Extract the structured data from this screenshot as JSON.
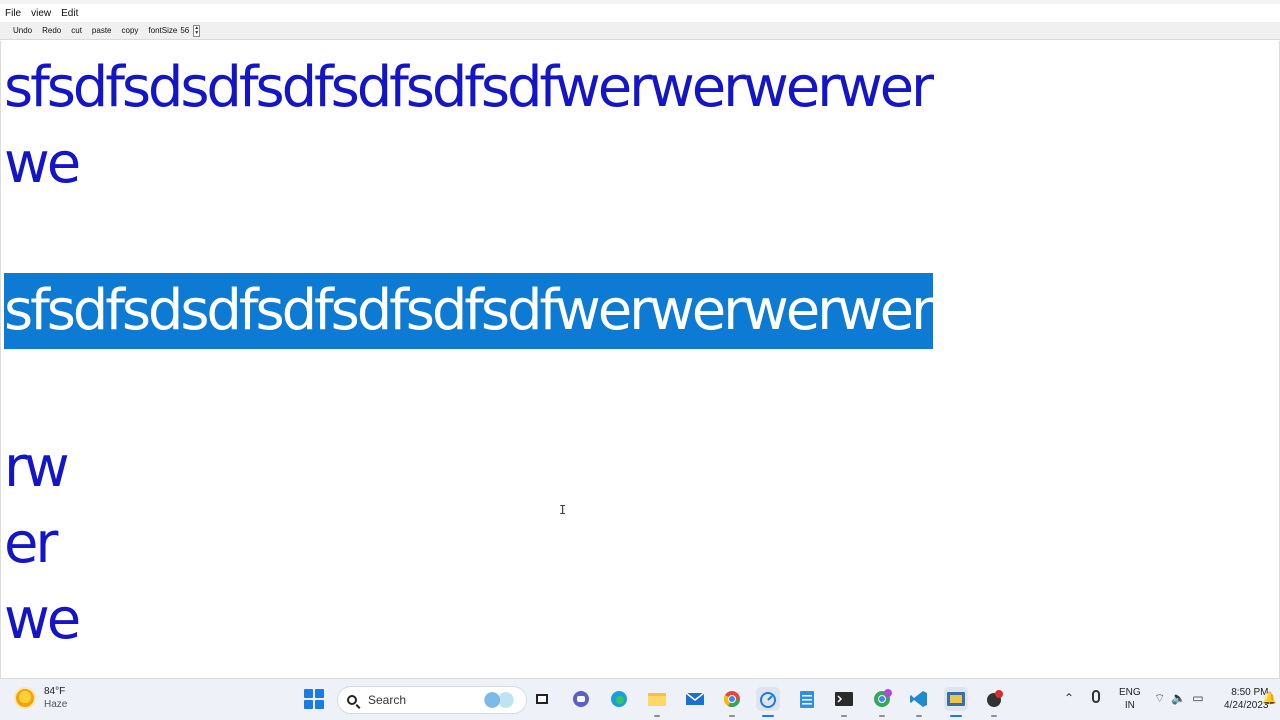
{
  "menu": [
    "File",
    "view",
    "Edit"
  ],
  "toolbar": {
    "undo": "Undo",
    "redo": "Redo",
    "cut": "cut",
    "paste": "paste",
    "copy": "copy",
    "font_size_label": "fontSize",
    "font_size_value": "56"
  },
  "editor": {
    "lines": [
      "sfsdfsdsdfsdfsdfsdfsdfwerwerwerwer",
      "we",
      "",
      "sfsdfsdsdfsdfsdfsdfsdfwerwerwerwer",
      "",
      "rw",
      "er",
      "we"
    ],
    "selected_line_index": 3,
    "text_color": "#1515c8",
    "selection_color": "#0d7ad4"
  },
  "taskbar": {
    "weather": {
      "temp": "84°F",
      "condition": "Haze",
      "icon": "sun-haze-icon"
    },
    "search_placeholder": "Search",
    "apps": [
      "windows-start-icon",
      "task-view-icon",
      "teams-chat-icon",
      "edge-icon",
      "file-explorer-icon",
      "mail-icon",
      "chrome-icon",
      "java-app-icon",
      "notepad-icon",
      "terminal-icon",
      "chrome-profile-icon",
      "vscode-icon",
      "editor-app-icon",
      "recording-app-icon"
    ],
    "language": {
      "line1": "ENG",
      "line2": "IN"
    },
    "clock": {
      "time": "8:50 PM",
      "date": "4/24/2023"
    }
  }
}
